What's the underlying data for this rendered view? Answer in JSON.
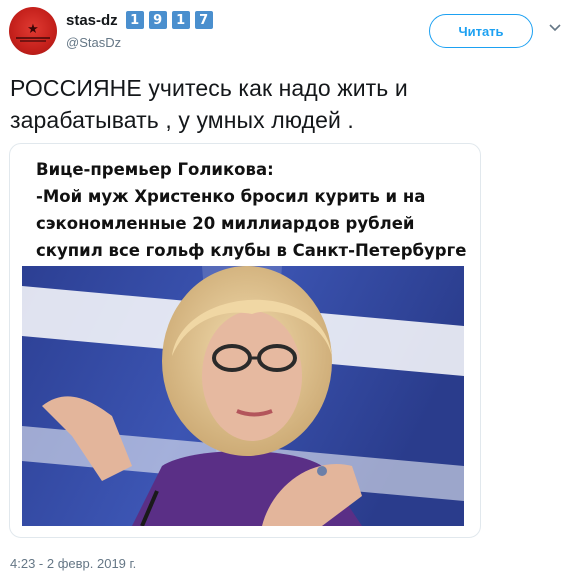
{
  "user": {
    "display_name": "stas-dz",
    "badges": [
      "1",
      "9",
      "1",
      "7"
    ],
    "handle": "@StasDz"
  },
  "follow_button": {
    "label": "Читать"
  },
  "tweet": {
    "text_line1": "РОССИЯНЕ учитесь как надо жить и",
    "text_line2": "зарабатывать , у умных людей ."
  },
  "card": {
    "caption": [
      "Вице-премьер Голикова:",
      "-Мой муж Христенко бросил курить и на",
      "сэкономленные 20 миллиардов рублей",
      "скупил все гольф клубы в Санкт-Петербурге"
    ]
  },
  "timestamp": "4:23 - 2 февр. 2019 г.",
  "colors": {
    "accent": "#1da1f2",
    "badge": "#4a8fce",
    "secondary_text": "#657786",
    "avatar": "#c4201b"
  },
  "icons": {
    "caret": "chevron-down-icon"
  }
}
